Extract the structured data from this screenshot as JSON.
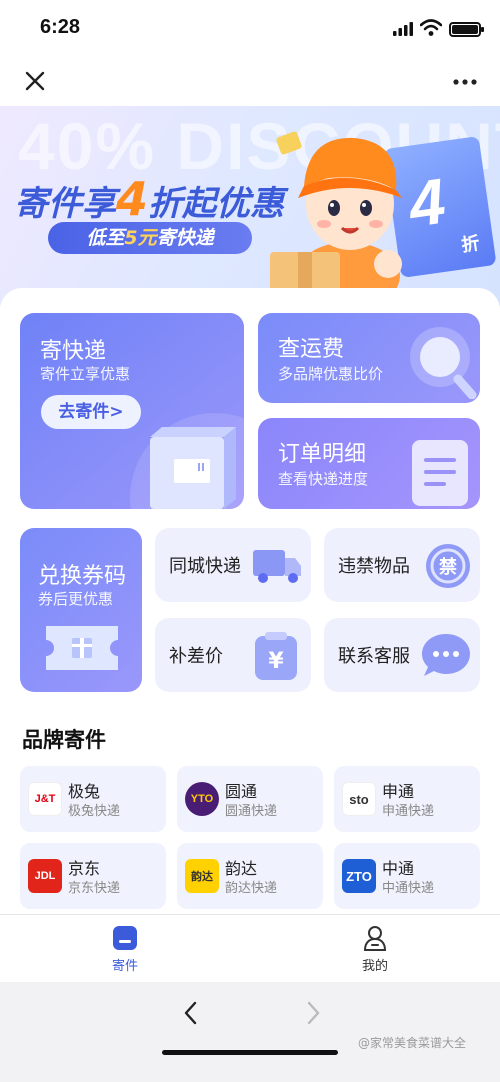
{
  "status_bar": {
    "time": "6:28"
  },
  "banner": {
    "ghost_text": "40% DISCOUNT",
    "headline_pre": "寄件享",
    "headline_num": "4",
    "headline_post": "折起优惠",
    "sub_pre": "低至",
    "sub_num": "5元",
    "sub_post": "寄快递",
    "ticket_number": "4",
    "ticket_unit": "折"
  },
  "cards": {
    "send": {
      "title": "寄快递",
      "subtitle": "寄件立享优惠",
      "button": "去寄件>"
    },
    "fee": {
      "title": "查运费",
      "subtitle": "多品牌优惠比价"
    },
    "order": {
      "title": "订单明细",
      "subtitle": "查看快递进度"
    },
    "coupon": {
      "title": "兑换券码",
      "subtitle": "券后更优惠"
    }
  },
  "tiles": {
    "city": "同城快递",
    "prohibited": "违禁物品",
    "prohibited_icon_text": "禁",
    "diff": "补差价",
    "diff_icon_text": "¥",
    "service": "联系客服"
  },
  "brands_section": {
    "title": "品牌寄件",
    "items": [
      {
        "name": "极兔",
        "sub": "极兔快递",
        "logo": "J&T"
      },
      {
        "name": "圆通",
        "sub": "圆通快递",
        "logo": "YTO"
      },
      {
        "name": "申通",
        "sub": "申通快递",
        "logo": "sto"
      },
      {
        "name": "京东",
        "sub": "京东快递",
        "logo": "JDL"
      },
      {
        "name": "韵达",
        "sub": "韵达快递",
        "logo": "韵达"
      },
      {
        "name": "中通",
        "sub": "中通快递",
        "logo": "ZTO"
      }
    ]
  },
  "tabbar": {
    "send": "寄件",
    "mine": "我的"
  },
  "watermark": "@家常美食菜谱大全",
  "colors": {
    "accent": "#4b5fe3",
    "card_purple": "#8a8ff9",
    "orange": "#ff8a1e"
  }
}
